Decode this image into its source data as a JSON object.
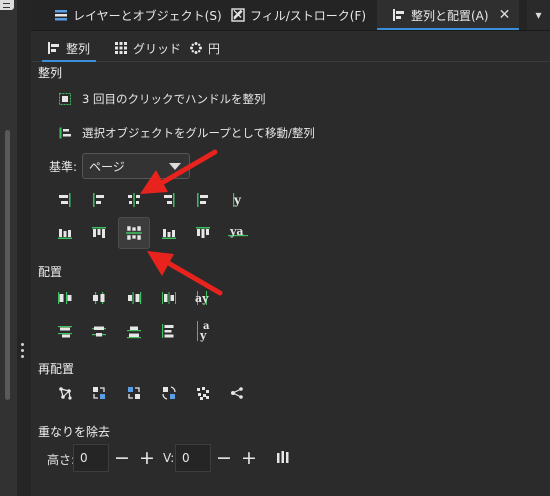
{
  "tabs": [
    {
      "label": "レイヤーとオブジェクト(S)",
      "icon": "layers-icon",
      "close": "✕",
      "active": false
    },
    {
      "label": "フィル/ストローク(F)",
      "icon": "fill-stroke-icon",
      "close": "✕",
      "active": false
    },
    {
      "label": "整列と配置(A)",
      "icon": "align-distribute-icon",
      "close": "✕",
      "active": true
    }
  ],
  "tab_more": "▾",
  "subtabs": [
    {
      "label": "整列",
      "icon": "align-icon",
      "active": true
    },
    {
      "label": "グリッド",
      "icon": "grid-icon",
      "active": false
    },
    {
      "label": "円",
      "icon": "circle-icon",
      "active": false
    }
  ],
  "align_section": {
    "title": "整列",
    "option_handles": "3 回目のクリックでハンドルを整列",
    "option_group": "選択オブジェクトをグループとして移動/整列",
    "relative_label": "基準:",
    "relative_value": "ページ"
  },
  "distribute_section": {
    "title": "配置"
  },
  "rearrange_section": {
    "title": "再配置"
  },
  "overlap_section": {
    "title": "重なりを除去",
    "height_label": "高さ:",
    "height_value": "0",
    "v_label": "V:",
    "v_value": "0",
    "minus": "−",
    "plus": "+"
  },
  "icon_glyphs": {
    "text_y": "y",
    "text_ya": "ya",
    "text_ay": "ay",
    "text_a": "a"
  },
  "colors": {
    "accent": "#3a8fd8",
    "icon_green": "#3fbf5f",
    "annotation_arrow": "#e8231e"
  }
}
